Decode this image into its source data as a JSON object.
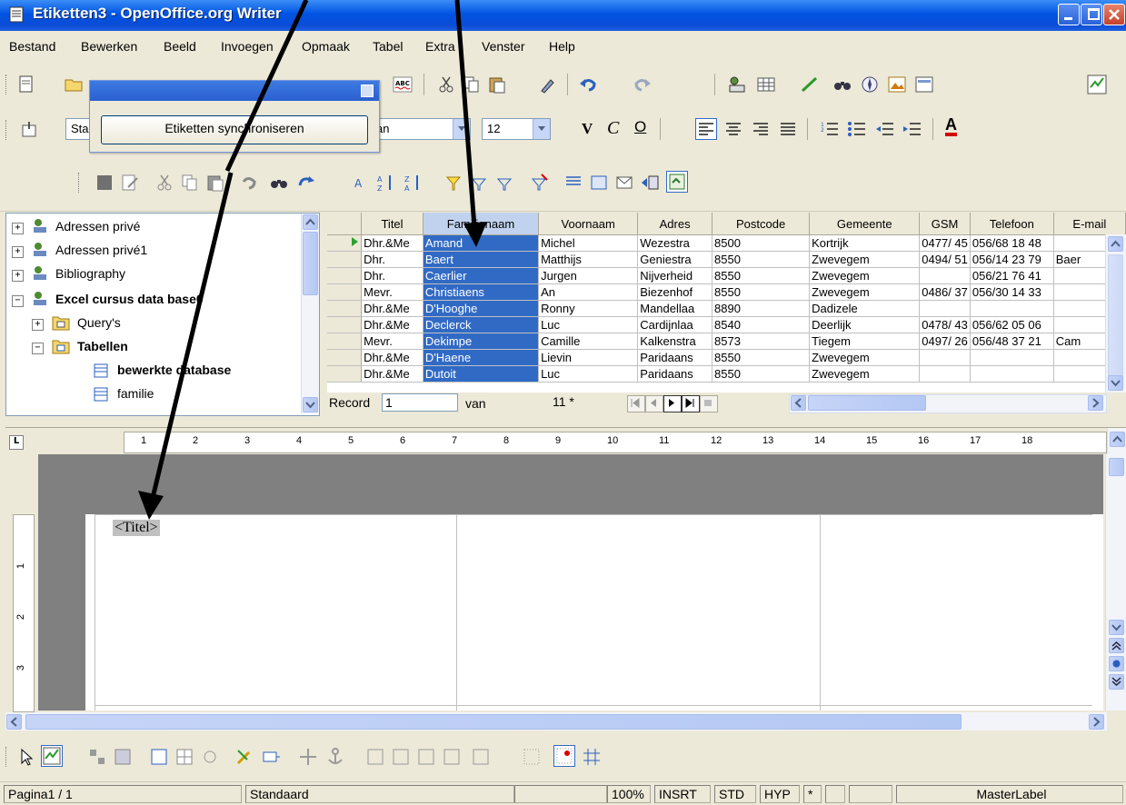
{
  "window": {
    "title": "Etiketten3 - OpenOffice.org Writer"
  },
  "menu": [
    "Bestand",
    "Bewerken",
    "Beeld",
    "Invoegen",
    "Opmaak",
    "Tabel",
    "Extra",
    "Venster",
    "Help"
  ],
  "formatting": {
    "style_value": "Sta",
    "font_value": "an",
    "size_value": "12"
  },
  "float_dialog": {
    "button_label": "Etiketten synchroniseren"
  },
  "tree": {
    "items": [
      {
        "label": "Adressen privé"
      },
      {
        "label": "Adressen privé1"
      },
      {
        "label": "Bibliography"
      },
      {
        "label": "Excel cursus data base0"
      },
      {
        "label": "Query's"
      },
      {
        "label": "Tabellen"
      },
      {
        "label": "bewerkte database"
      },
      {
        "label": "familie"
      }
    ]
  },
  "grid": {
    "columns": [
      "Titel",
      "Familienaam",
      "Voornaam",
      "Adres",
      "Postcode",
      "Gemeente",
      "GSM",
      "Telefoon",
      "E-mail"
    ],
    "rows": [
      [
        "Dhr.&Me",
        "Amand",
        "Michel",
        "Wezestra",
        "8500",
        "Kortrijk",
        "0477/ 45",
        "056/68 18 48",
        ""
      ],
      [
        "Dhr.",
        "Baert",
        "Matthijs",
        "Geniestra",
        "8550",
        "Zwevegem",
        "0494/ 51",
        "056/14 23 79",
        "Baer"
      ],
      [
        "Dhr.",
        "Caerlier",
        "Jurgen",
        "Nijverheid",
        "8550",
        "Zwevegem",
        "",
        "056/21 76 41",
        ""
      ],
      [
        "Mevr.",
        "Christiaens",
        "An",
        "Biezenhof",
        "8550",
        "Zwevegem",
        "0486/ 37",
        "056/30 14 33",
        ""
      ],
      [
        "Dhr.&Me",
        "D'Hooghe",
        "Ronny",
        "Mandellaa",
        "8890",
        "Dadizele",
        "",
        "",
        ""
      ],
      [
        "Dhr.&Me",
        "Declerck",
        "Luc",
        "Cardijnlaa",
        "8540",
        "Deerlijk",
        "0478/ 43",
        "056/62 05 06",
        ""
      ],
      [
        "Mevr.",
        "Dekimpe",
        "Camille",
        "Kalkenstra",
        "8573",
        "Tiegem",
        "0497/ 26",
        "056/48 37 21",
        "Cam"
      ],
      [
        "Dhr.&Me",
        "D'Haene",
        "Lievin",
        "Paridaans",
        "8550",
        "Zwevegem",
        "",
        "",
        ""
      ],
      [
        "Dhr.&Me",
        "Dutoit",
        "Luc",
        "Paridaans",
        "8550",
        "Zwevegem",
        "",
        "",
        ""
      ]
    ]
  },
  "record_nav": {
    "label": "Record",
    "value": "1",
    "of_label": "van",
    "total": "11 *"
  },
  "ruler": {
    "marks": [
      "1",
      "2",
      "3",
      "4",
      "5",
      "6",
      "7",
      "8",
      "9",
      "10",
      "11",
      "12",
      "13",
      "14",
      "15",
      "16",
      "17",
      "18"
    ]
  },
  "vruler": {
    "marks": [
      "1",
      "2",
      "3"
    ]
  },
  "document": {
    "field_text": "<Titel>"
  },
  "status": {
    "page": "Pagina1 / 1",
    "style": "Standaard",
    "zoom": "100%",
    "insert": "INSRT",
    "selection": "STD",
    "hyperlink": "HYP",
    "modified": "*",
    "signature": "",
    "label": "MasterLabel"
  }
}
